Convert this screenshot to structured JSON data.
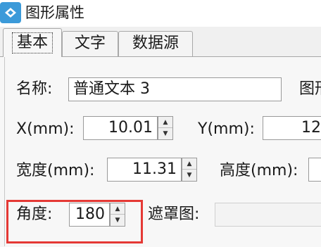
{
  "window": {
    "title": "图形属性"
  },
  "tabs": [
    {
      "label": "基本",
      "active": true
    },
    {
      "label": "文字",
      "active": false
    },
    {
      "label": "数据源",
      "active": false
    }
  ],
  "form": {
    "name_label": "名称:",
    "name_value": "普通文本 3",
    "right_cut_label": "图形",
    "x_label": "X(mm):",
    "x_value": "10.01",
    "y_label": "Y(mm):",
    "y_value": "12",
    "width_label": "宽度(mm):",
    "width_value": "11.31",
    "height_label": "高度(mm):",
    "angle_label": "角度:",
    "angle_value": "180",
    "mask_label": "遮罩图:"
  },
  "colors": {
    "highlight": "#e53935",
    "app_icon": "#3b9ad9"
  },
  "icons": {
    "app": "app-logo-icon",
    "spin_up": "▲",
    "spin_down": "▼"
  }
}
